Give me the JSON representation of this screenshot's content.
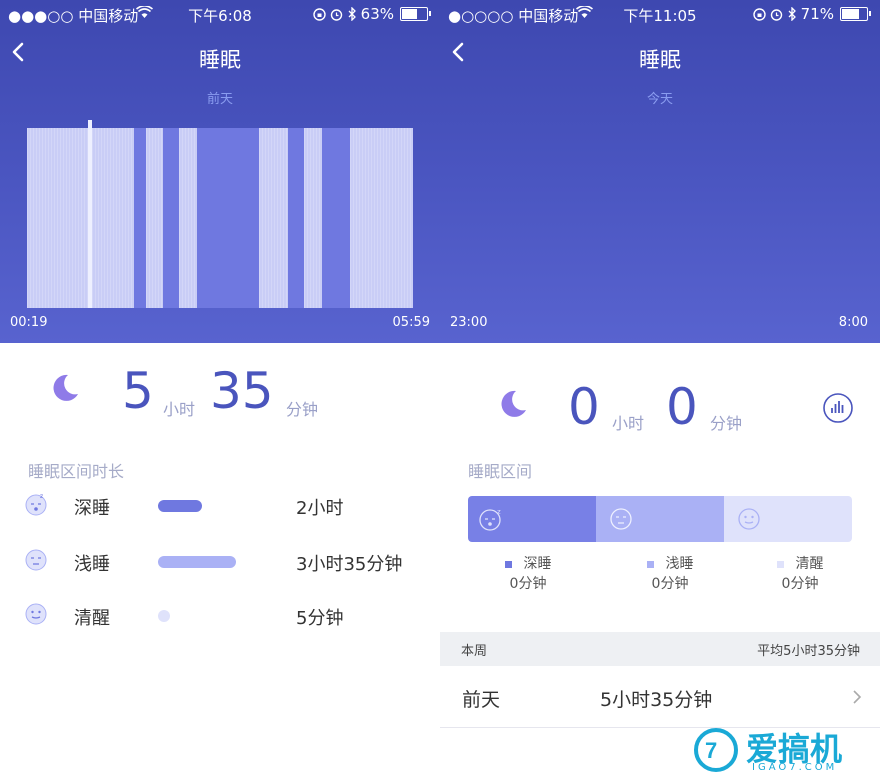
{
  "left": {
    "status": {
      "signal": "●●●○○ 中国移动",
      "time": "下午6:08",
      "battery": "63%",
      "battery_level": 0.63
    },
    "header": {
      "title": "睡眠",
      "subtitle": "前天"
    },
    "timeline": {
      "start": "00:19",
      "end": "05:59"
    },
    "summary": {
      "hours": "5",
      "hour_unit": "小时",
      "minutes": "35",
      "minute_unit": "分钟"
    },
    "section_title": "睡眠区间时长",
    "rows": [
      {
        "label": "深睡",
        "value": "2小时",
        "minutes": 120
      },
      {
        "label": "浅睡",
        "value": "3小时35分钟",
        "minutes": 215
      },
      {
        "label": "清醒",
        "value": "5分钟",
        "minutes": 5
      }
    ]
  },
  "right": {
    "status": {
      "signal": "●○○○○ 中国移动",
      "time": "下午11:05",
      "battery": "71%",
      "battery_level": 0.71
    },
    "header": {
      "title": "睡眠",
      "subtitle": "今天"
    },
    "timeline": {
      "start": "23:00",
      "end": "8:00"
    },
    "summary": {
      "hours": "0",
      "hour_unit": "小时",
      "minutes": "0",
      "minute_unit": "分钟"
    },
    "section_title": "睡眠区间",
    "legend": [
      {
        "label": "深睡",
        "value": "0分钟"
      },
      {
        "label": "浅睡",
        "value": "0分钟"
      },
      {
        "label": "清醒",
        "value": "0分钟"
      }
    ],
    "week": {
      "label": "本周",
      "average": "平均5小时35分钟"
    },
    "list": [
      {
        "day": "前天",
        "duration": "5小时35分钟"
      }
    ]
  },
  "watermark": {
    "brand": "爱搞机",
    "site": "IGAO7.COM"
  },
  "colors": {
    "deep": "#6f78e0",
    "light": "#aab1f5",
    "awake": "#dfe2fb",
    "accent": "#4a55bd"
  }
}
